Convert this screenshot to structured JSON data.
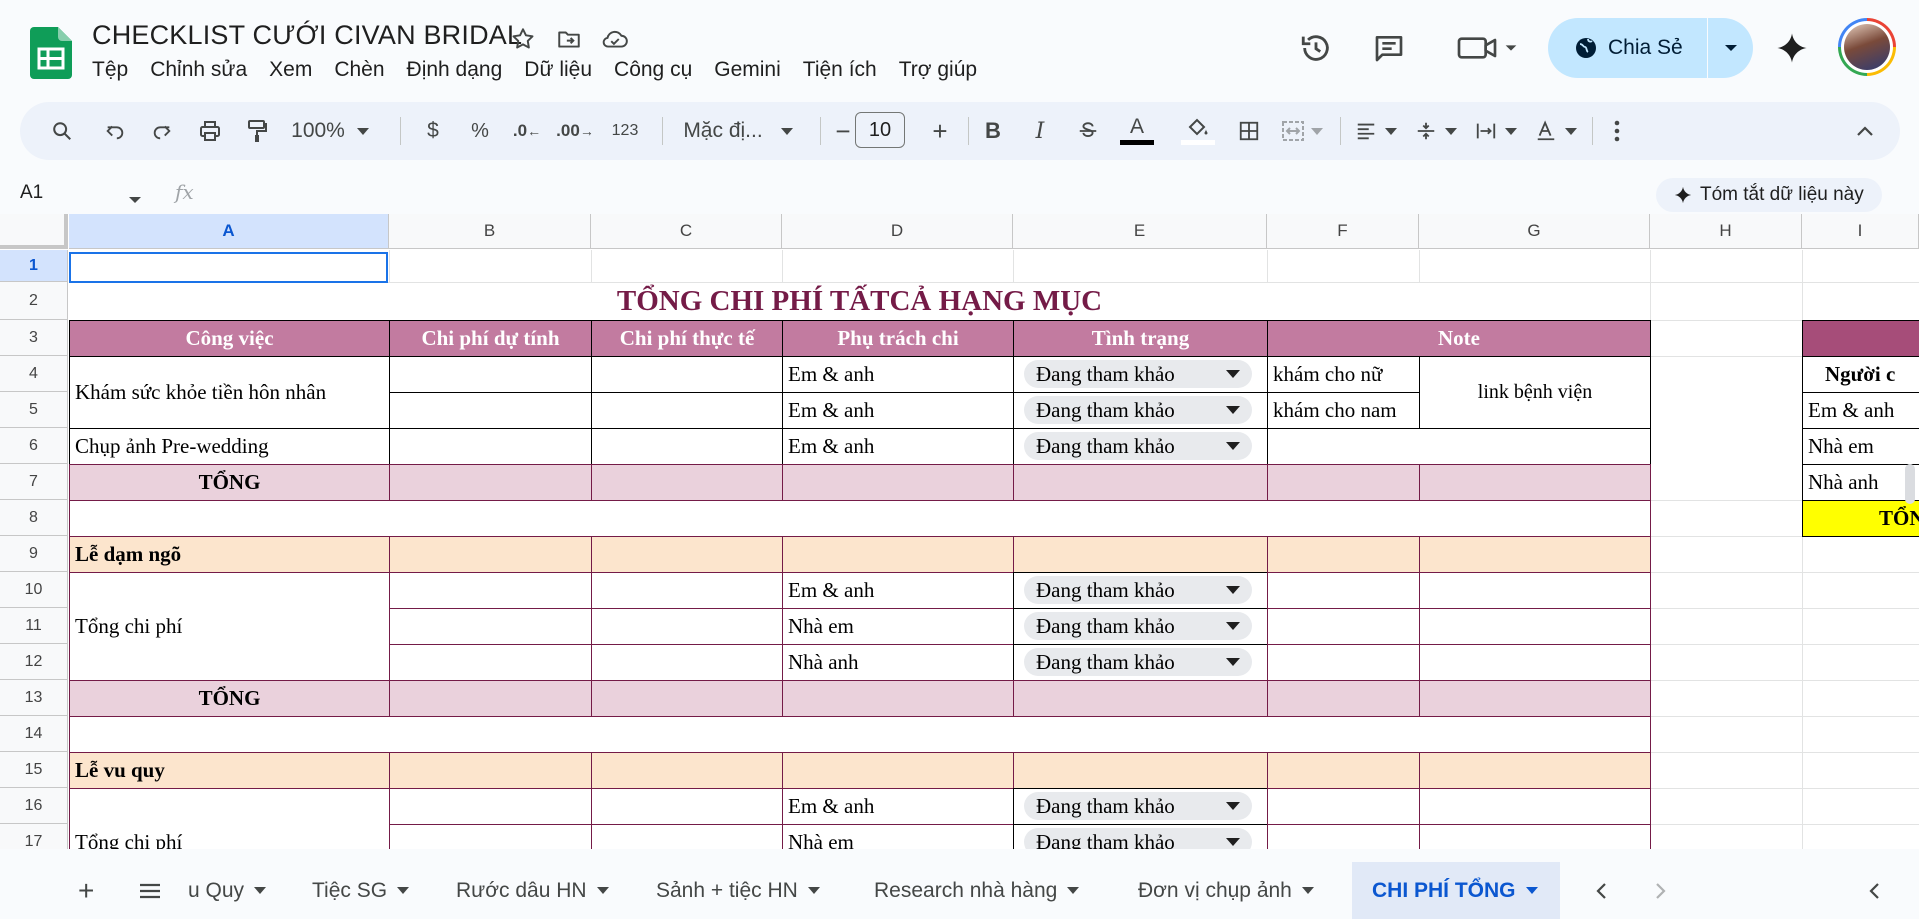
{
  "doc": {
    "title": "CHECKLIST CƯỚI CIVAN BRIDAL"
  },
  "menu": [
    "Tệp",
    "Chỉnh sửa",
    "Xem",
    "Chèn",
    "Định dạng",
    "Dữ liệu",
    "Công cụ",
    "Gemini",
    "Tiện ích",
    "Trợ giúp"
  ],
  "share": {
    "label": "Chia Sẻ"
  },
  "toolbar": {
    "zoom": "100%",
    "currency": "$",
    "percent": "%",
    "dec_decrease": ".0",
    "dec_increase": ".00",
    "number_format": "123",
    "font": "Mặc đị...",
    "font_size": "10",
    "minus": "−",
    "plus": "+",
    "bold": "B",
    "italic": "I",
    "text_color": "A"
  },
  "formula": {
    "cell_ref": "A1",
    "fx": "fx",
    "summary": "Tóm tắt dữ liệu này"
  },
  "columns": [
    "A",
    "B",
    "C",
    "D",
    "E",
    "F",
    "G",
    "H",
    "I"
  ],
  "rows": [
    "1",
    "2",
    "3",
    "4",
    "5",
    "6",
    "7",
    "8",
    "9",
    "10",
    "11",
    "12",
    "13",
    "14",
    "15",
    "16",
    "17"
  ],
  "sheet": {
    "title": "TỔNG CHI PHÍ TẤTCẢ HẠNG MỤC",
    "headers": [
      "Công việc",
      "Chi phí dự tính",
      "Chi phí thực tế",
      "Phụ trách chi",
      "Tình trạng",
      "Note"
    ],
    "r4_task": "Khám sức khỏe tiền hôn nhân",
    "r4_owner": "Em & anh",
    "r4_status": "Đang tham khảo",
    "r4_note": "khám cho nữ",
    "r4_link": "link bệnh viện",
    "r5_owner": "Em & anh",
    "r5_status": "Đang tham khảo",
    "r5_note": "khám cho nam",
    "r6_task": "Chụp ảnh Pre-wedding",
    "r6_owner": "Em & anh",
    "r6_status": "Đang tham khảo",
    "r7_total": "TỔNG",
    "r9_section": "Lễ dạm ngõ",
    "r10_task": "Tổng chi phí",
    "r10_owner": "Em & anh",
    "r10_status": "Đang tham khảo",
    "r11_owner": "Nhà em",
    "r11_status": "Đang tham khảo",
    "r12_owner": "Nhà anh",
    "r12_status": "Đang tham khảo",
    "r13_total": "TỔNG",
    "r15_section": "Lễ vu quy",
    "r16_task": "Tổng chi phí",
    "r16_owner": "Em & anh",
    "r16_status": "Đang tham khảo",
    "r17_owner": "Nhà em",
    "r17_status": "Đang tham khảo",
    "side_header": "Người c",
    "side_r5": "Em & anh",
    "side_r6": "Nhà em",
    "side_r7": "Nhà anh",
    "side_total": "TỔNG"
  },
  "tabs": {
    "add": "+",
    "items": [
      "u Quy",
      "Tiệc SG",
      "Rước dâu HN",
      "Sảnh + tiệc HN",
      "Research nhà hàng",
      "Đơn vị chụp ảnh"
    ],
    "active": "CHI PHÍ TỔNG"
  },
  "colors": {
    "header_pink": "#c27ba0",
    "light_pink": "#ead1dc",
    "peach": "#fce5cd",
    "title_maroon": "#741b47",
    "share_blue": "#c2e7ff",
    "selection_blue": "#1a73e8"
  }
}
